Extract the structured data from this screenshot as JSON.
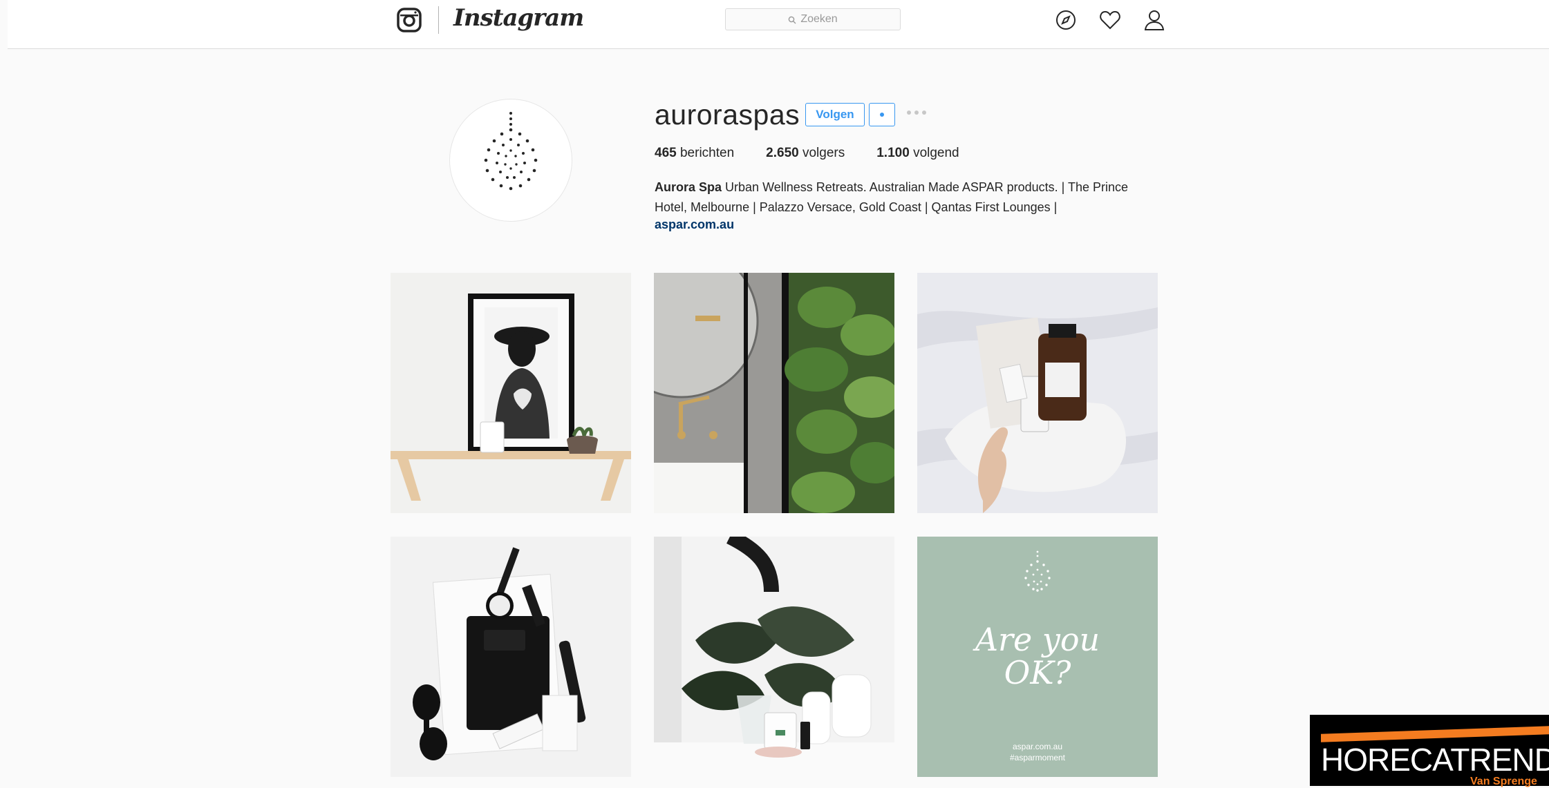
{
  "nav": {
    "logo_text": "Instagram",
    "search_placeholder": "Zoeken",
    "icons": [
      "compass-icon",
      "heart-icon",
      "person-icon"
    ]
  },
  "profile": {
    "username": "auroraspas",
    "follow_label": "Volgen",
    "stats": [
      {
        "value": "465",
        "label": "berichten"
      },
      {
        "value": "2.650",
        "label": "volgers"
      },
      {
        "value": "1.100",
        "label": "volgend"
      }
    ],
    "bio_name": "Aurora Spa",
    "bio_text": "Urban Wellness Retreats. Australian Made ASPAR products. | The Prince Hotel, Melbourne | Palazzo Versace, Gold Coast | Qantas First Lounges |",
    "bio_link": "aspar.com.au"
  },
  "posts": [
    {
      "id": "post-1",
      "subject": "framed-art-on-shelf"
    },
    {
      "id": "post-2",
      "subject": "bathroom-mirror-plants"
    },
    {
      "id": "post-3",
      "subject": "product-gift-box"
    },
    {
      "id": "post-4",
      "subject": "flatlay-watch-notebook"
    },
    {
      "id": "post-5",
      "subject": "monstera-vase"
    },
    {
      "id": "post-6",
      "subject": "are-you-ok-graphic",
      "headline": "Are you OK?",
      "footer_link": "aspar.com.au",
      "footer_tag": "#asparmoment"
    }
  ],
  "watermark": {
    "text": "HORECATREND",
    "sub": "Van Sprenge"
  },
  "colors": {
    "accent": "#3897f0",
    "link": "#003569",
    "background": "#fafafa",
    "tile_green": "#a8bfb0",
    "watermark_orange": "#f47c20"
  }
}
